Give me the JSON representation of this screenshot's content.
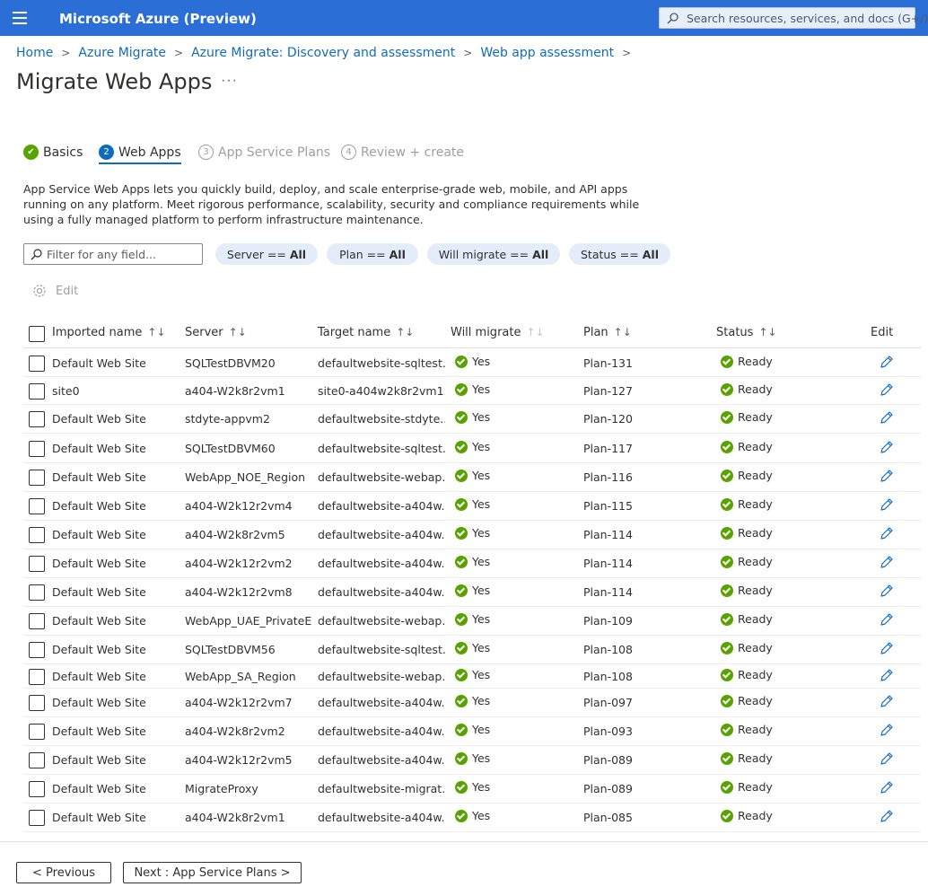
{
  "topbar": {
    "brand": "Microsoft Azure (Preview)",
    "search_placeholder": "Search resources, services, and docs (G+/)"
  },
  "breadcrumb": [
    "Home",
    "Azure Migrate",
    "Azure Migrate: Discovery and assessment",
    "Web app assessment"
  ],
  "page": {
    "title": "Migrate Web Apps",
    "more": "···"
  },
  "steps": [
    {
      "num": "",
      "label": "Basics",
      "state": "done"
    },
    {
      "num": "2",
      "label": "Web Apps",
      "state": "active"
    },
    {
      "num": "3",
      "label": "App Service Plans",
      "state": "todo"
    },
    {
      "num": "4",
      "label": "Review + create",
      "state": "todo"
    }
  ],
  "description": "App Service Web Apps lets you quickly build, deploy, and scale enterprise-grade web, mobile, and API apps running on any platform. Meet rigorous performance, scalability, security and compliance requirements while using a fully managed platform to perform infrastructure maintenance.",
  "filters": {
    "placeholder": "Filter for any field...",
    "pills": [
      {
        "key": "Server ==",
        "value": "All"
      },
      {
        "key": "Plan ==",
        "value": "All"
      },
      {
        "key": "Will migrate ==",
        "value": "All"
      },
      {
        "key": "Status ==",
        "value": "All"
      }
    ]
  },
  "commands": {
    "edit": "Edit"
  },
  "table": {
    "columns": [
      "Imported name",
      "Server",
      "Target name",
      "Will migrate",
      "Plan",
      "Status",
      "Edit"
    ],
    "rows": [
      {
        "name": "Default Web Site",
        "server": "SQLTestDBVM20",
        "target": "defaultwebsite-sqltest...",
        "migrate": "Yes",
        "plan": "Plan-131",
        "status": "Ready"
      },
      {
        "name": "site0",
        "server": "a404-W2k8r2vm1",
        "target": "site0-a404w2k8r2vm1...",
        "migrate": "Yes",
        "plan": "Plan-127",
        "status": "Ready"
      },
      {
        "name": "Default Web Site",
        "server": "stdyte-appvm2",
        "target": "defaultwebsite-stdyte...",
        "migrate": "Yes",
        "plan": "Plan-120",
        "status": "Ready"
      },
      {
        "name": "Default Web Site",
        "server": "SQLTestDBVM60",
        "target": "defaultwebsite-sqltest...",
        "migrate": "Yes",
        "plan": "Plan-117",
        "status": "Ready"
      },
      {
        "name": "Default Web Site",
        "server": "WebApp_NOE_Region",
        "target": "defaultwebsite-webap...",
        "migrate": "Yes",
        "plan": "Plan-116",
        "status": "Ready"
      },
      {
        "name": "Default Web Site",
        "server": "a404-W2k12r2vm4",
        "target": "defaultwebsite-a404w...",
        "migrate": "Yes",
        "plan": "Plan-115",
        "status": "Ready"
      },
      {
        "name": "Default Web Site",
        "server": "a404-W2k8r2vm5",
        "target": "defaultwebsite-a404w...",
        "migrate": "Yes",
        "plan": "Plan-114",
        "status": "Ready"
      },
      {
        "name": "Default Web Site",
        "server": "a404-W2k12r2vm2",
        "target": "defaultwebsite-a404w...",
        "migrate": "Yes",
        "plan": "Plan-114",
        "status": "Ready"
      },
      {
        "name": "Default Web Site",
        "server": "a404-W2k12r2vm8",
        "target": "defaultwebsite-a404w...",
        "migrate": "Yes",
        "plan": "Plan-114",
        "status": "Ready"
      },
      {
        "name": "Default Web Site",
        "server": "WebApp_UAE_PrivateEP",
        "target": "defaultwebsite-webap...",
        "migrate": "Yes",
        "plan": "Plan-109",
        "status": "Ready"
      },
      {
        "name": "Default Web Site",
        "server": "SQLTestDBVM56",
        "target": "defaultwebsite-sqltest...",
        "migrate": "Yes",
        "plan": "Plan-108",
        "status": "Ready"
      },
      {
        "name": "Default Web Site",
        "server": "WebApp_SA_Region",
        "target": "defaultwebsite-webap...",
        "migrate": "Yes",
        "plan": "Plan-108",
        "status": "Ready"
      },
      {
        "name": "Default Web Site",
        "server": "a404-W2k12r2vm7",
        "target": "defaultwebsite-a404w...",
        "migrate": "Yes",
        "plan": "Plan-097",
        "status": "Ready"
      },
      {
        "name": "Default Web Site",
        "server": "a404-W2k8r2vm2",
        "target": "defaultwebsite-a404w...",
        "migrate": "Yes",
        "plan": "Plan-093",
        "status": "Ready"
      },
      {
        "name": "Default Web Site",
        "server": "a404-W2k12r2vm5",
        "target": "defaultwebsite-a404w...",
        "migrate": "Yes",
        "plan": "Plan-089",
        "status": "Ready"
      },
      {
        "name": "Default Web Site",
        "server": "MigrateProxy",
        "target": "defaultwebsite-migrat...",
        "migrate": "Yes",
        "plan": "Plan-089",
        "status": "Ready"
      },
      {
        "name": "Default Web Site",
        "server": "a404-W2k8r2vm1",
        "target": "defaultwebsite-a404w...",
        "migrate": "Yes",
        "plan": "Plan-085",
        "status": "Ready"
      }
    ]
  },
  "footer": {
    "previous": "< Previous",
    "next": "Next : App Service Plans >"
  },
  "colors": {
    "accent": "#0f6cbd",
    "topbar": "#2b6fd6",
    "success": "#57a300"
  }
}
